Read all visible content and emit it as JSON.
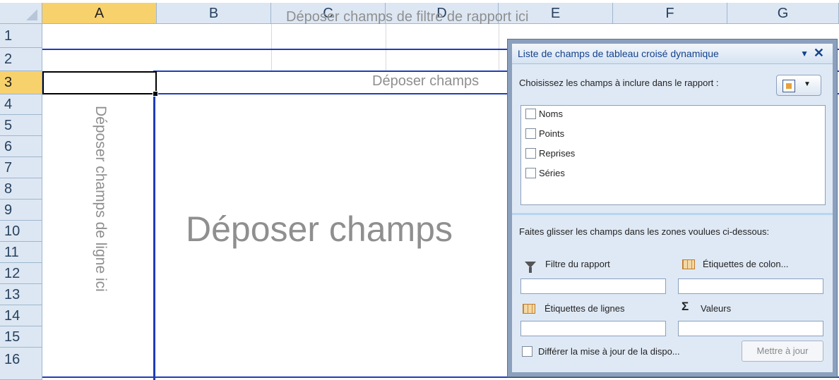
{
  "columns": [
    "A",
    "B",
    "C",
    "D",
    "E",
    "F",
    "G"
  ],
  "rows": [
    "1",
    "2",
    "3",
    "4",
    "5",
    "6",
    "7",
    "8",
    "9",
    "10",
    "11",
    "12",
    "13",
    "14",
    "15",
    "16"
  ],
  "selected_cell": "A3",
  "pivot_placeholders": {
    "filter": "Déposer champs de filtre de rapport ici",
    "column": "Déposer champs",
    "row": "Déposer champs de ligne ici",
    "values": "Déposer champs"
  },
  "field_list": {
    "title": "Liste de champs de tableau croisé dynamique",
    "choose_label": "Choisissez les champs à inclure dans le rapport :",
    "fields": [
      {
        "label": "Noms",
        "checked": false
      },
      {
        "label": "Points",
        "checked": false
      },
      {
        "label": "Reprises",
        "checked": false
      },
      {
        "label": "Séries",
        "checked": false
      }
    ],
    "drag_label": "Faites glisser les champs dans les zones voulues ci-dessous:",
    "areas": {
      "filter": "Filtre du rapport",
      "columns": "Étiquettes de colon...",
      "rows": "Étiquettes de lignes",
      "values": "Valeurs"
    },
    "defer_label": "Différer la mise à jour de la dispo...",
    "defer_checked": false,
    "update_button": "Mettre à jour"
  },
  "icons": {
    "dropdown": "chevron-down-icon",
    "close": "close-icon",
    "layout": "field-list-layout-icon",
    "filter": "filter-icon",
    "columns": "column-grid-icon",
    "rows": "row-grid-icon",
    "values": "sigma-icon"
  }
}
